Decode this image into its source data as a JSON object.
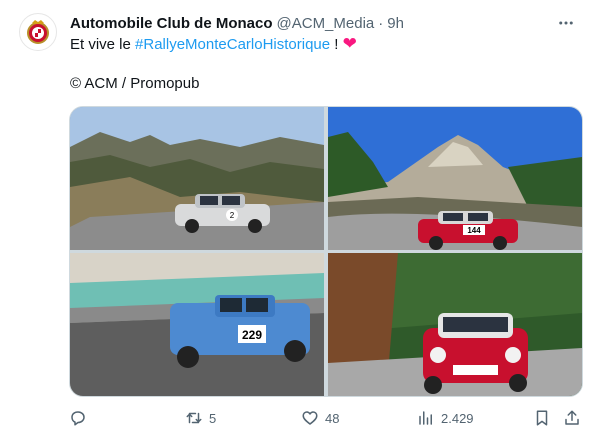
{
  "tweet": {
    "author_name": "Automobile Club de Monaco",
    "author_handle": "@ACM_Media",
    "separator": "·",
    "timestamp": "9h",
    "text_prefix": "Et vive le ",
    "hashtag": "#RallyeMonteCarloHistorique",
    "text_suffix": " !",
    "heart_emoji": "❤",
    "credit": "© ACM / Promopub"
  },
  "media": {
    "photos": [
      {
        "car_number": "2"
      },
      {
        "car_number": "144"
      },
      {
        "car_number": "229"
      },
      {
        "car_number": ""
      }
    ]
  },
  "actions": {
    "reply_count": "",
    "retweet_count": "5",
    "like_count": "48",
    "view_count": "2.429"
  },
  "colors": {
    "accent": "#1d9bf0",
    "secondary_text": "#536471",
    "heart": "#f91880"
  },
  "icons": [
    "more-icon",
    "reply-icon",
    "retweet-icon",
    "like-icon",
    "views-icon",
    "bookmark-icon",
    "share-icon"
  ]
}
